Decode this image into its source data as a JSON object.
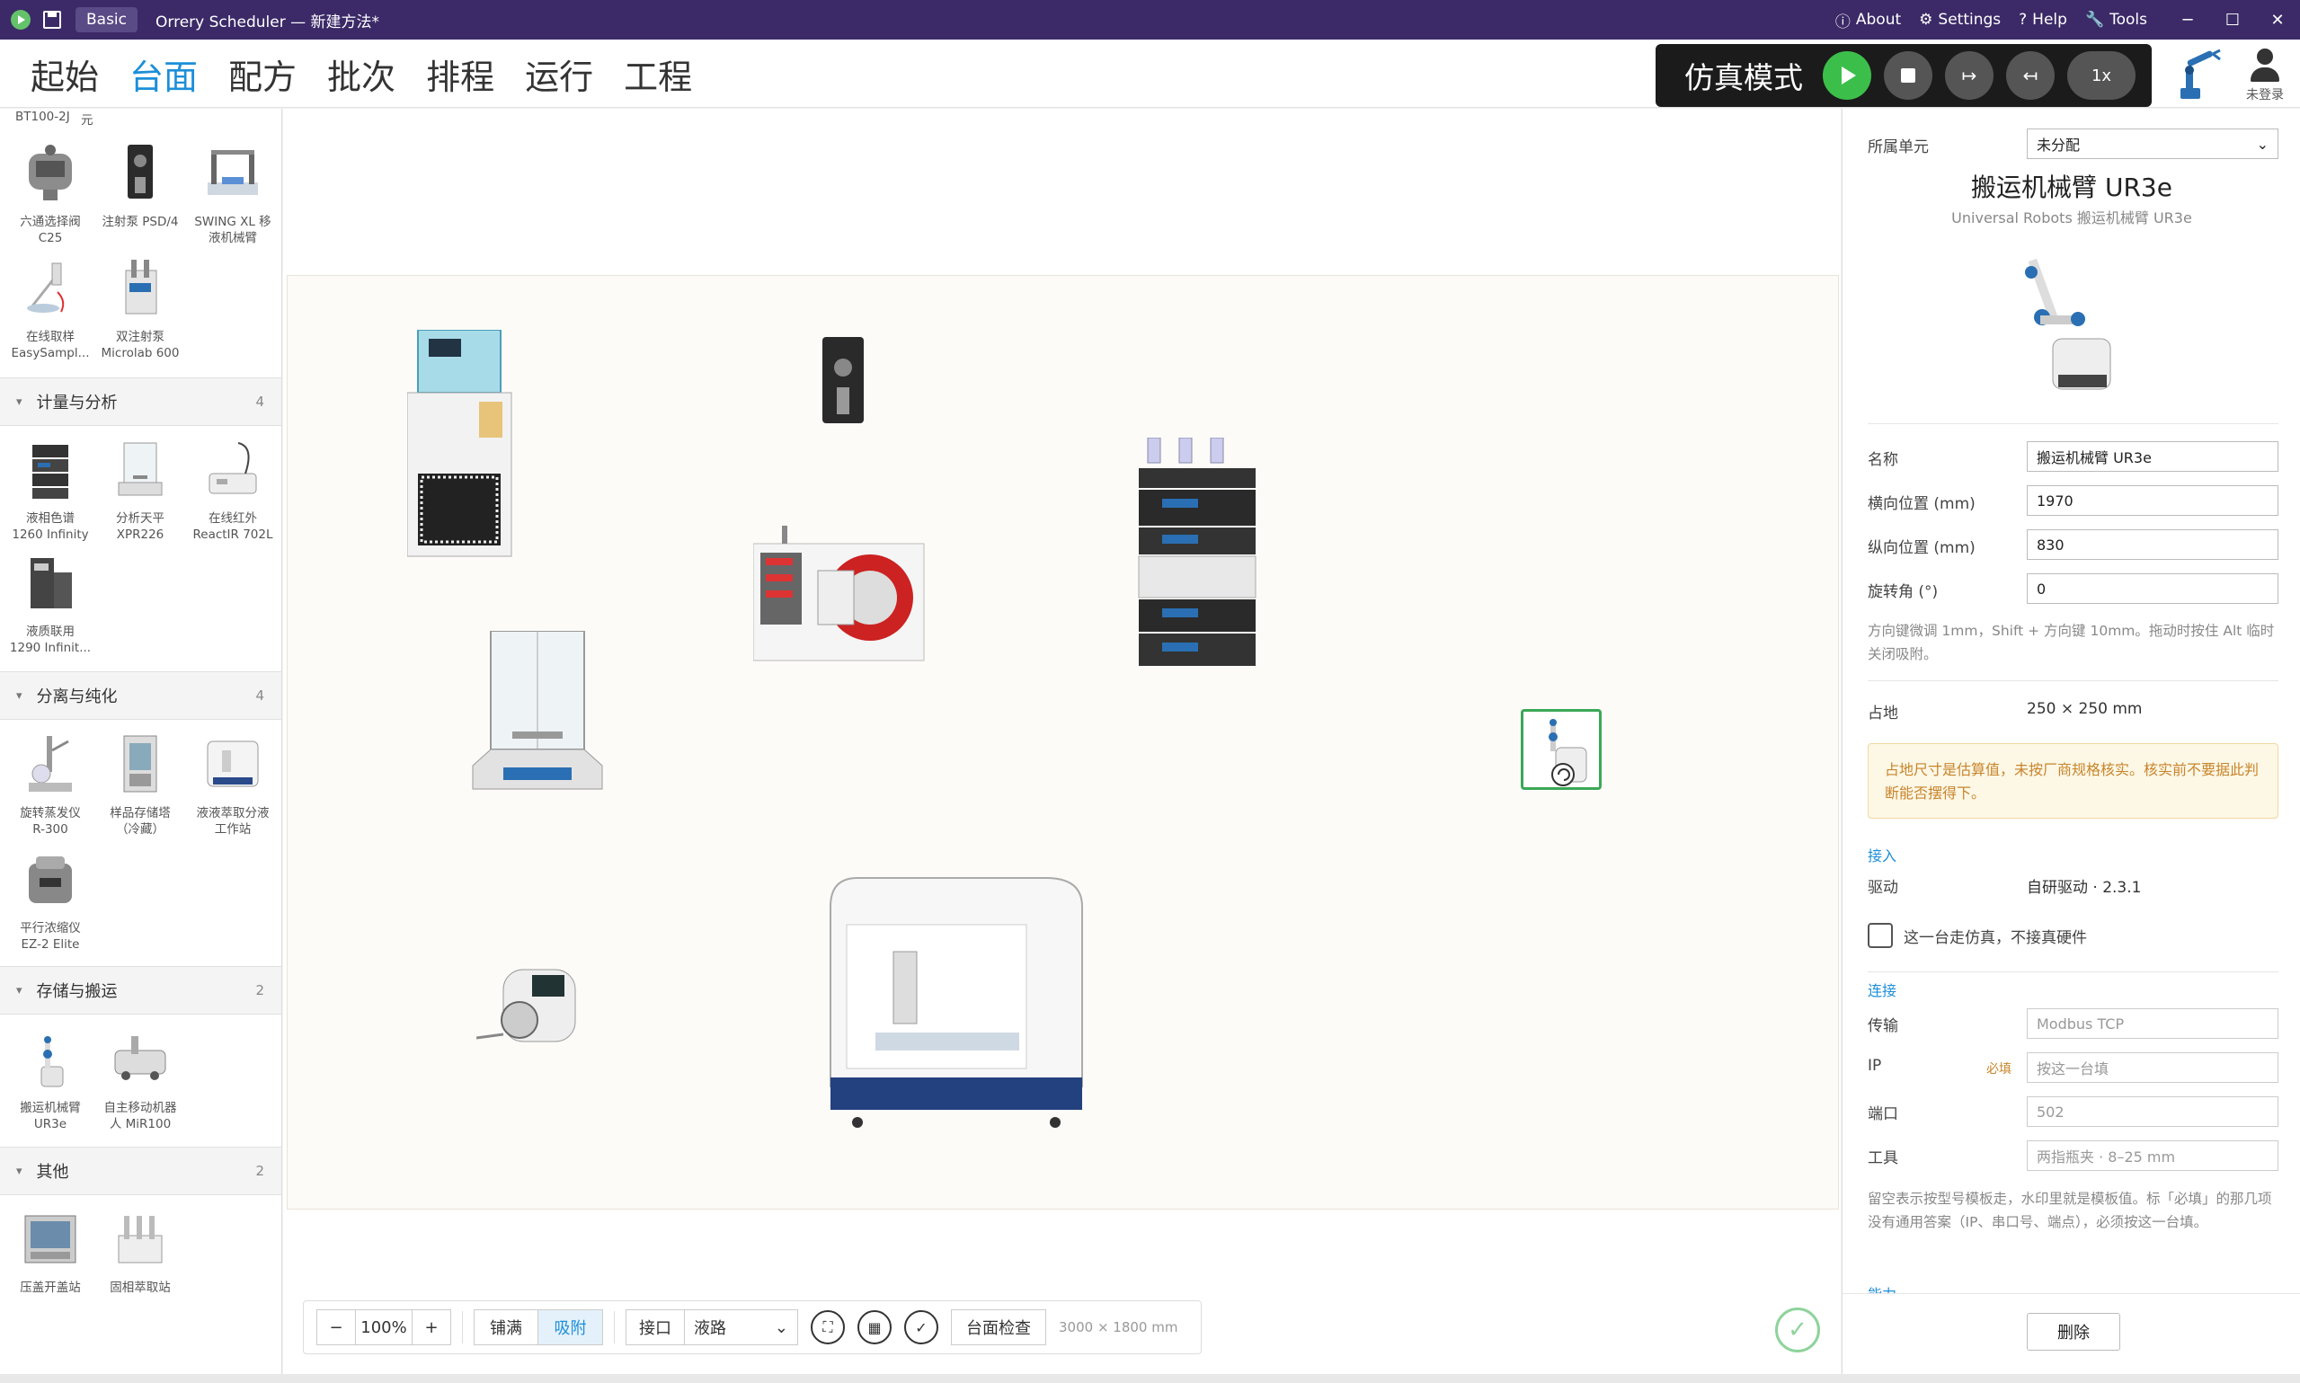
{
  "window": {
    "mode_badge": "Basic",
    "title": "Orrery Scheduler — 新建方法*",
    "menu": {
      "about": "About",
      "settings": "Settings",
      "help": "Help",
      "tools": "Tools"
    },
    "controls": {
      "minimize": "─",
      "maximize": "☐",
      "close": "✕"
    }
  },
  "nav": {
    "tabs": [
      "起始",
      "台面",
      "配方",
      "批次",
      "排程",
      "运行",
      "工程"
    ],
    "active_tab": "台面"
  },
  "sim": {
    "label": "仿真模式",
    "speed": "1x"
  },
  "user": {
    "status": "未登录"
  },
  "palette": {
    "cut_labels": [
      "BT100-2J",
      "元"
    ],
    "categories": [
      {
        "name": "计量与分析",
        "count": "4"
      },
      {
        "name": "分离与纯化",
        "count": "4"
      },
      {
        "name": "存储与搬运",
        "count": "2"
      },
      {
        "name": "其他",
        "count": "2"
      }
    ],
    "devices": [
      {
        "l1": "六通选择阀",
        "l2": "C25"
      },
      {
        "l1": "注射泵 PSD/4",
        "l2": ""
      },
      {
        "l1": "SWING XL 移",
        "l2": "液机械臂"
      },
      {
        "l1": "在线取样",
        "l2": "EasySampl..."
      },
      {
        "l1": "双注射泵",
        "l2": "Microlab 600"
      },
      {
        "l1": "液相色谱",
        "l2": "1260 Infinity"
      },
      {
        "l1": "分析天平",
        "l2": "XPR226"
      },
      {
        "l1": "在线红外",
        "l2": "ReactIR 702L"
      },
      {
        "l1": "液质联用",
        "l2": "1290 Infinit..."
      },
      {
        "l1": "旋转蒸发仪",
        "l2": "R-300"
      },
      {
        "l1": "样品存储塔",
        "l2": "（冷藏）"
      },
      {
        "l1": "液液萃取分液",
        "l2": "工作站"
      },
      {
        "l1": "平行浓缩仪",
        "l2": "EZ-2 Elite"
      },
      {
        "l1": "搬运机械臂",
        "l2": "UR3e"
      },
      {
        "l1": "自主移动机器",
        "l2": "人 MiR100"
      },
      {
        "l1": "压盖开盖站",
        "l2": ""
      },
      {
        "l1": "固相萃取站",
        "l2": ""
      }
    ]
  },
  "toolbar": {
    "zoom_out": "−",
    "zoom": "100%",
    "zoom_in": "+",
    "fill": "铺满",
    "snap": "吸附",
    "interface_label": "接口",
    "interface_value": "液路",
    "check": "台面检查",
    "dims": "3000 × 1800 mm"
  },
  "panel": {
    "unit_label": "所属单元",
    "unit_value": "未分配",
    "device_title": "搬运机械臂 UR3e",
    "device_subtitle": "Universal Robots 搬运机械臂 UR3e",
    "name_label": "名称",
    "name_value": "搬运机械臂 UR3e",
    "x_label": "横向位置 (mm)",
    "x_value": "1970",
    "y_label": "纵向位置 (mm)",
    "y_value": "830",
    "rot_label": "旋转角 (°)",
    "rot_value": "0",
    "move_hint": "方向键微调 1mm，Shift + 方向键 10mm。拖动时按住 Alt 临时关闭吸附。",
    "footprint_label": "占地",
    "footprint_value": "250 × 250 mm",
    "warning": "占地尺寸是估算值，未按厂商规格核实。核实前不要据此判断能否摆得下。",
    "access_section": "接入",
    "driver_label": "驱动",
    "driver_value": "自研驱动 · 2.3.1",
    "sim_checkbox": "这一台走仿真，不接真硬件",
    "conn_section": "连接",
    "transport_label": "传输",
    "transport_ph": "Modbus TCP",
    "ip_label": "IP",
    "ip_required": "必填",
    "ip_ph": "按这一台填",
    "port_label": "端口",
    "port_ph": "502",
    "tool_label": "工具",
    "tool_ph": "两指瓶夹 · 8–25 mm",
    "conn_hint": "留空表示按型号模板走，水印里就是模板值。标「必填」的那几项没有通用答案（IP、串口号、端点），必须按这一台填。",
    "capability_section": "能力",
    "delete": "删除"
  }
}
